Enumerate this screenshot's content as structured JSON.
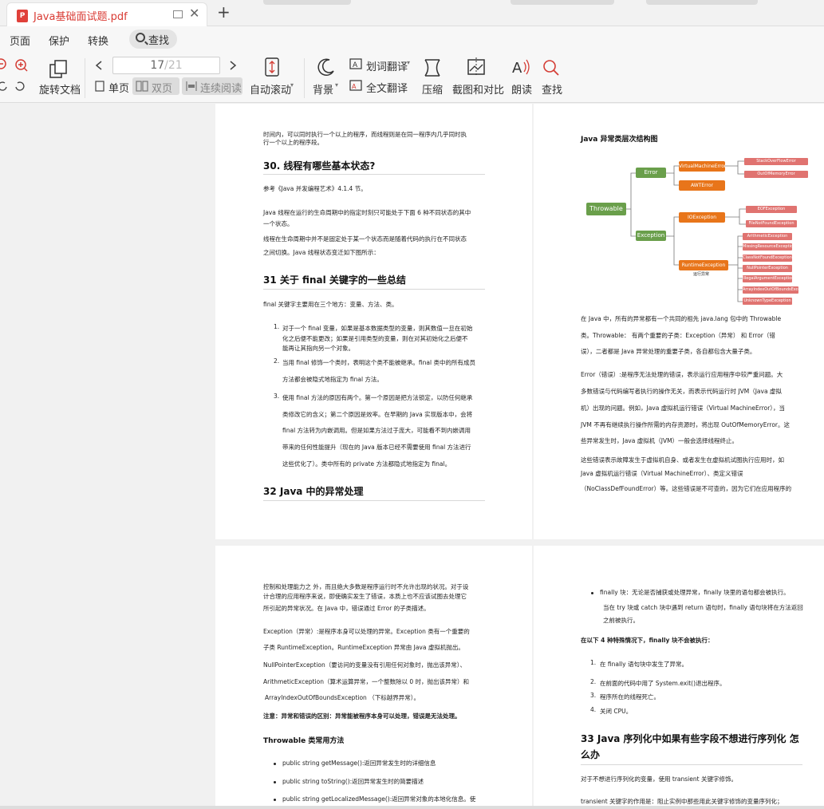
{
  "tab": {
    "title": "Java基础面试题.pdf"
  },
  "menu": {
    "items": [
      "页面",
      "保护",
      "转换"
    ],
    "search": "查找"
  },
  "toolbar": {
    "rotate": "旋转文档",
    "page_current": "17",
    "page_total": "/21",
    "single": "单页",
    "double": "双页",
    "continuous": "连续阅读",
    "autoscroll": "自动滚动",
    "background": "背景",
    "word_translate": "划词翻译",
    "full_translate": "全文翻译",
    "compress": "压缩",
    "screenshot": "截图和对比",
    "read": "朗读",
    "find": "查找"
  },
  "p1": {
    "l1": "时间内，可以同时执行一个以上的程序，而线程则是在同一程序内几乎同时执",
    "l2": "行一个以上的程序段。",
    "h30": "30. 线程有哪些基本状态?",
    "ref": "参考《Java 并发编程艺术》4.1.4 节。",
    "s1": "Java 线程在运行的生命周期中的指定时刻只可能处于下面 6 种不同状态的其中",
    "s2": "一个状态。",
    "s3": "线程在生命周期中并不是固定处于某一个状态而是随着代码的执行在不同状态",
    "s4": "之间切换。Java 线程状态变迁如下图所示：",
    "h31": "31 关于 final 关键字的一些总结",
    "f0": "final 关键字主要用在三个地方：变量、方法、类。",
    "i1a": "对于一个 final 变量，如果是基本数据类型的变量，则其数值一旦在初始",
    "i1b": "化之后便不能更改；如果是引用类型的变量，则在对其初始化之后便不",
    "i1c": "能再让其指向另一个对象。",
    "i2a": "当用 final 修饰一个类时，表明这个类不能被继承。final 类中的所有成员",
    "i2b": "方法都会被隐式地指定为 final 方法。",
    "i3a": "使用 final 方法的原因有两个。第一个原因是把方法锁定，以防任何继承",
    "i3b": "类修改它的含义；第二个原因是效率。在早期的 Java 实现版本中，会将",
    "i3c": "final 方法转为内嵌调用。但是如果方法过于庞大，可能看不到内嵌调用",
    "i3d": "带来的任何性能提升（现在的 Java 版本已经不需要使用 final 方法进行",
    "i3e": "这些优化了）。类中所有的 private 方法都隐式地指定为 final。",
    "h32": "32 Java 中的异常处理"
  },
  "p2": {
    "title": "Java 异常类层次结构图",
    "nodes": {
      "throwable": "Throwable",
      "error": "Error",
      "exception": "Exception",
      "vme": "VirtualMachineError",
      "awt": "AWTError",
      "soe": "StackOverFlowError",
      "oom": "OutOfMemoryError",
      "ioe": "IOException",
      "eof": "EOFException",
      "fnf": "FileNotFoundException",
      "rte": "RuntimeException",
      "rte_sub": "运行异常",
      "ae": "ArithmeticException",
      "mre": "MissingResourceException",
      "cnf": "ClassNotFoundException",
      "npe": "NullPointerException",
      "iae": "IllegalArgumentException",
      "aioobe": "ArrayIndexOutOfBoundsException",
      "ute": "UnknownTypeException"
    },
    "a1": "在 Java 中，所有的异常都有一个共同的祖先 java.lang 包中的 Throwable",
    "a2": "类。Throwable： 有两个重要的子类：Exception（异常） 和 Error（错",
    "a3": "误），二者都是 Java 异常处理的重要子类，各自都包含大量子类。",
    "e1": "Error（错误）:是程序无法处理的错误，表示运行应用程序中较严重问题。大",
    "e2": "多数错误与代码编写者执行的操作无关，而表示代码运行时 JVM（Java 虚拟",
    "e3": "机）出现的问题。例如，Java 虚拟机运行错误（Virtual MachineError），当",
    "e4": "JVM 不再有继续执行操作所需的内存资源时，将出现 OutOfMemoryError。这",
    "e5": "些异常发生时，Java 虚拟机（JVM）一般会选择线程终止。",
    "c1": "这些错误表示故障发生于虚拟机自身、或者发生在虚拟机试图执行应用时，如",
    "c2": "Java 虚拟机运行错误（Virtual MachineError）、类定义错误",
    "c3": "（NoClassDefFoundError）等。这些错误是不可查的，因为它们在应用程序的"
  },
  "p3": {
    "l1": "控制和处理能力之 外，而且绝大多数是程序运行时不允许出现的状况。对于设",
    "l2": "计合理的应用程序来说，即使确实发生了错误，本质上也不应该试图去处理它",
    "l3": "所引起的异常状况。在 Java 中，错误通过 Error 的子类描述。",
    "x1": "Exception（异常）:是程序本身可以处理的异常。Exception 类有一个重要的",
    "x2": "子类 RuntimeException。RuntimeException 异常由 Java 虚拟机抛出。",
    "x3": "NullPointerException（要访问的变量没有引用任何对象时，抛出该异常）、",
    "x4": "ArithmeticException（算术运算异常，一个整数除以 0 时，抛出该异常）和",
    "x5": "ArrayIndexOutOfBoundsException （下标越界异常）。",
    "note": "注意：异常和错误的区别：异常能被程序本身可以处理，错误是无法处理。",
    "th": "Throwable 类常用方法",
    "m1": "public string getMessage():返回异常发生时的详细信息",
    "m2": "public string toString():返回异常发生时的简要描述",
    "m3": "public string getLocalizedMessage():返回异常对象的本地化信息。使"
  },
  "p4": {
    "f1": "finally 块：无论是否捕获或处理异常，finally 块里的语句都会被执行。",
    "f2": "当在 try 块或 catch 块中遇到 return 语句时，finally 语句块将在方法返回",
    "f3": "之前被执行。",
    "cond": "在以下 4 种特殊情况下，finally 块不会被执行：",
    "n1": "在 finally 语句块中发生了异常。",
    "n2": "在前面的代码中用了 System.exit()退出程序。",
    "n3": "程序所在的线程死亡。",
    "n4": "关闭 CPU。",
    "h33a": "33 Java 序列化中如果有些字段不想进行序列化 怎",
    "h33b": "么办",
    "t1": "对于不想进行序列化的变量，使用 transient 关键字修饰。",
    "t2": "transient 关键字的作用是：阻止实例中那些用此关键字修饰的变量序列化；"
  }
}
